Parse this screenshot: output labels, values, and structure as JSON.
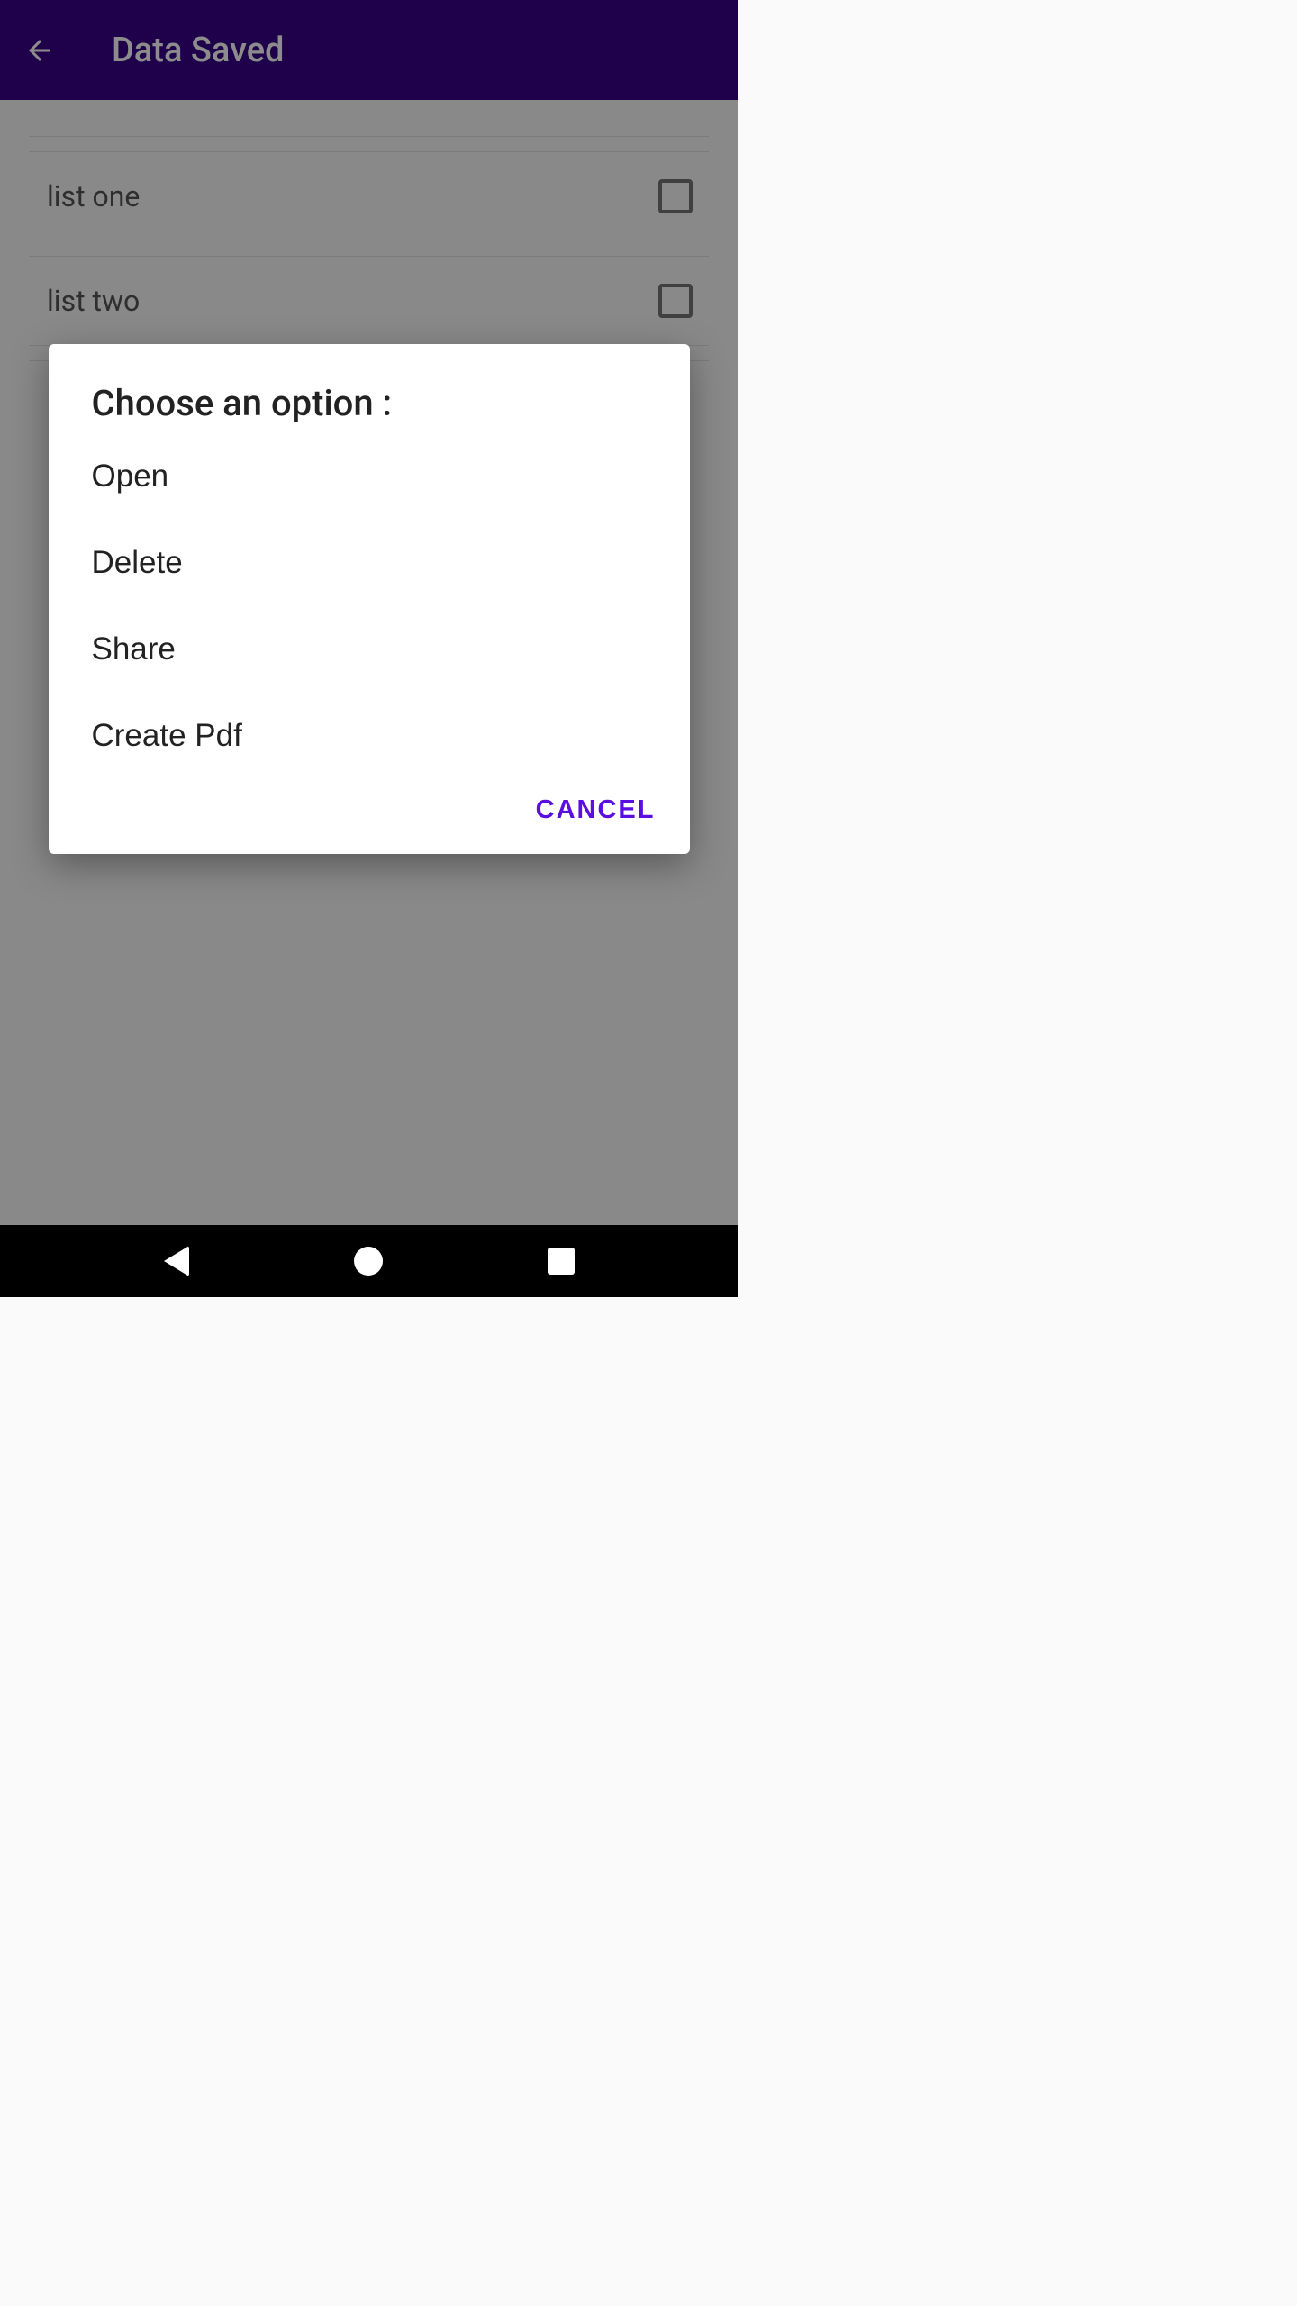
{
  "header": {
    "title": "Data Saved"
  },
  "list": {
    "items": [
      {
        "label": "list one",
        "checked": false
      },
      {
        "label": "list two",
        "checked": false
      }
    ]
  },
  "dialog": {
    "title": "Choose an option :",
    "options": [
      {
        "label": "Open"
      },
      {
        "label": "Delete"
      },
      {
        "label": "Share"
      },
      {
        "label": "Create Pdf"
      }
    ],
    "cancel_label": "CANCEL"
  },
  "colors": {
    "appbar_bg": "#3a0088",
    "accent": "#5b0ee0"
  }
}
